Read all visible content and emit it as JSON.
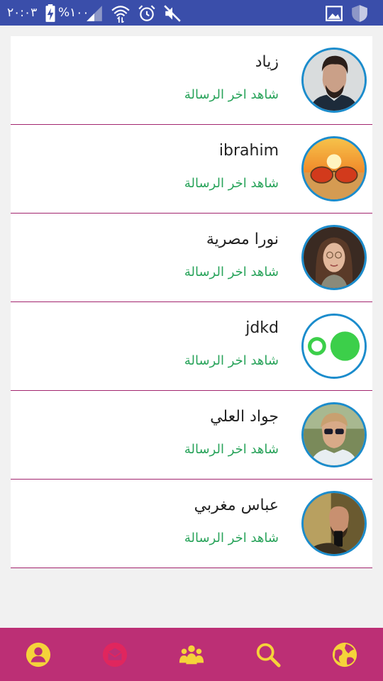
{
  "status_bar": {
    "time": "٢٠:٠٣",
    "battery": "%١٠٠",
    "icons": [
      "battery-charging-icon",
      "signal-icon",
      "wifi-icon",
      "alarm-icon",
      "mute-icon",
      "gallery-icon",
      "shield-icon"
    ]
  },
  "chats": [
    {
      "name": "زياد",
      "subtitle": "شاهد اخر الرسالة",
      "avatar": "man-photo"
    },
    {
      "name": "ibrahim",
      "subtitle": "شاهد اخر الرسالة",
      "avatar": "sunglasses-sunset-photo"
    },
    {
      "name": "نورا مصرية",
      "subtitle": "شاهد اخر الرسالة",
      "avatar": "woman-photo"
    },
    {
      "name": "jdkd",
      "subtitle": "شاهد اخر الرسالة",
      "avatar": "green-circles-icon"
    },
    {
      "name": "جواد العلي",
      "subtitle": "شاهد اخر الرسالة",
      "avatar": "young-man-sunglasses-photo"
    },
    {
      "name": "عباس مغربي",
      "subtitle": "شاهد اخر الرسالة",
      "avatar": "man-phone-photo"
    }
  ],
  "bottom_nav": {
    "items": [
      "profile-icon",
      "messages-icon",
      "groups-icon",
      "search-icon",
      "globe-icon"
    ],
    "active_color": "#f5d33a",
    "secondary_color": "#e0265e",
    "bar_color": "#bc2f75"
  },
  "colors": {
    "status_bar": "#3a4eaa",
    "subtitle": "#28a35a",
    "divider": "#a2256e",
    "avatar_border": "#1b8ccc"
  }
}
